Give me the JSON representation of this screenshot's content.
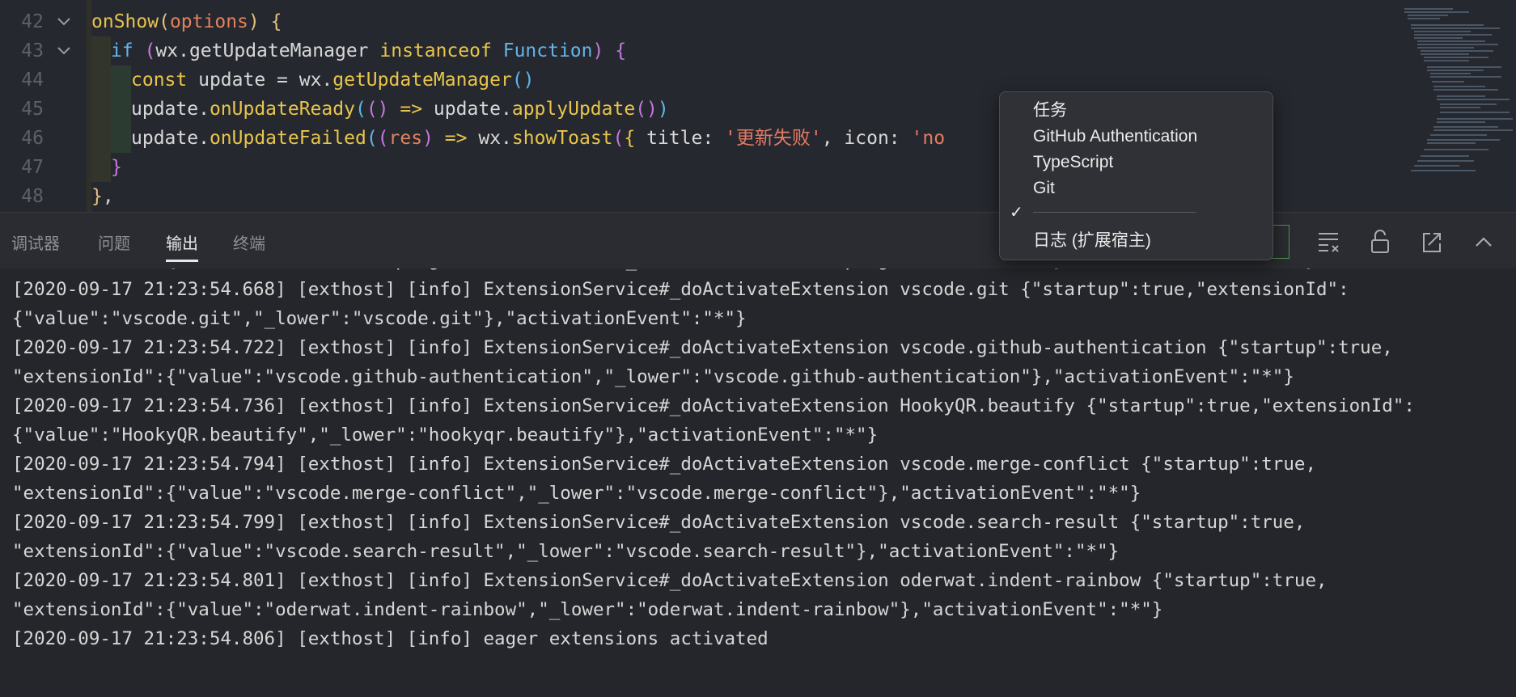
{
  "editor": {
    "lines": [
      {
        "num": "42",
        "tokens": [
          [
            "kw-fn",
            "onShow"
          ],
          [
            "p-orange",
            "("
          ],
          [
            "param",
            "options"
          ],
          [
            "p-orange",
            ")"
          ],
          [
            "sym",
            " "
          ],
          [
            "p-orange",
            "{"
          ]
        ],
        "indent": 0,
        "fold": true
      },
      {
        "num": "43",
        "tokens": [
          [
            "kw",
            "if"
          ],
          [
            "sym",
            " "
          ],
          [
            "paren-p",
            "("
          ],
          [
            "prop",
            "wx.getUpdateManager "
          ],
          [
            "kw2",
            "instanceof"
          ],
          [
            "sym",
            " "
          ],
          [
            "cls",
            "Function"
          ],
          [
            "paren-p",
            ")"
          ],
          [
            "sym",
            " "
          ],
          [
            "paren-p",
            "{"
          ]
        ],
        "indent": 1,
        "fold": true
      },
      {
        "num": "44",
        "tokens": [
          [
            "kw2",
            "const"
          ],
          [
            "sym",
            " update = wx."
          ],
          [
            "call",
            "getUpdateManager"
          ],
          [
            "paren-b",
            "()"
          ]
        ],
        "indent": 2,
        "fold": false
      },
      {
        "num": "45",
        "tokens": [
          [
            "sym",
            "update."
          ],
          [
            "call",
            "onUpdateReady"
          ],
          [
            "paren-b",
            "("
          ],
          [
            "paren-p",
            "()"
          ],
          [
            "sym",
            " "
          ],
          [
            "op",
            "=>"
          ],
          [
            "sym",
            " update."
          ],
          [
            "call",
            "applyUpdate"
          ],
          [
            "paren-p",
            "()"
          ],
          [
            "paren-b",
            ")"
          ]
        ],
        "indent": 2,
        "fold": false
      },
      {
        "num": "46",
        "tokens": [
          [
            "sym",
            "update."
          ],
          [
            "call",
            "onUpdateFailed"
          ],
          [
            "paren-b",
            "("
          ],
          [
            "paren-p",
            "("
          ],
          [
            "param",
            "res"
          ],
          [
            "paren-p",
            ")"
          ],
          [
            "sym",
            " "
          ],
          [
            "op",
            "=>"
          ],
          [
            "sym",
            " wx."
          ],
          [
            "call",
            "showToast"
          ],
          [
            "paren-p",
            "("
          ],
          [
            "op",
            "{"
          ],
          [
            "sym",
            " title: "
          ],
          [
            "str",
            "'更新失败'"
          ],
          [
            "sym",
            ", icon: "
          ],
          [
            "str",
            "'no"
          ]
        ],
        "indent": 2,
        "fold": false
      },
      {
        "num": "47",
        "tokens": [
          [
            "paren-p",
            "}"
          ]
        ],
        "indent": 1,
        "fold": false
      },
      {
        "num": "48",
        "tokens": [
          [
            "p-orange",
            "}"
          ],
          [
            "sym",
            ","
          ]
        ],
        "indent": 0,
        "fold": false
      }
    ]
  },
  "panel": {
    "tabs": [
      {
        "label": "调试器",
        "active": false
      },
      {
        "label": "问题",
        "active": false
      },
      {
        "label": "输出",
        "active": true
      },
      {
        "label": "终端",
        "active": false
      }
    ],
    "icons": [
      "clear-output-icon",
      "lock-scroll-icon",
      "open-log-icon",
      "maximize-panel-icon"
    ]
  },
  "dropdown": {
    "items": [
      "任务",
      "GitHub Authentication",
      "TypeScript",
      "Git"
    ],
    "selected": "日志 (扩展宿主)"
  },
  "output": {
    "lines": [
      "\"extensionId\":{\"value\":\"wechat.miniprogram.emmet-wxml\",\"_lower\":\"wechat.miniprogram.emmet-wxml\"},\"activationEvent\":\"*\"}",
      "[2020-09-17 21:23:54.668] [exthost] [info] ExtensionService#_doActivateExtension vscode.git {\"startup\":true,\"extensionId\":",
      "{\"value\":\"vscode.git\",\"_lower\":\"vscode.git\"},\"activationEvent\":\"*\"}",
      "[2020-09-17 21:23:54.722] [exthost] [info] ExtensionService#_doActivateExtension vscode.github-authentication {\"startup\":true,",
      "\"extensionId\":{\"value\":\"vscode.github-authentication\",\"_lower\":\"vscode.github-authentication\"},\"activationEvent\":\"*\"}",
      "[2020-09-17 21:23:54.736] [exthost] [info] ExtensionService#_doActivateExtension HookyQR.beautify {\"startup\":true,\"extensionId\":",
      "{\"value\":\"HookyQR.beautify\",\"_lower\":\"hookyqr.beautify\"},\"activationEvent\":\"*\"}",
      "[2020-09-17 21:23:54.794] [exthost] [info] ExtensionService#_doActivateExtension vscode.merge-conflict {\"startup\":true,",
      "\"extensionId\":{\"value\":\"vscode.merge-conflict\",\"_lower\":\"vscode.merge-conflict\"},\"activationEvent\":\"*\"}",
      "[2020-09-17 21:23:54.799] [exthost] [info] ExtensionService#_doActivateExtension vscode.search-result {\"startup\":true,",
      "\"extensionId\":{\"value\":\"vscode.search-result\",\"_lower\":\"vscode.search-result\"},\"activationEvent\":\"*\"}",
      "[2020-09-17 21:23:54.801] [exthost] [info] ExtensionService#_doActivateExtension oderwat.indent-rainbow {\"startup\":true,",
      "\"extensionId\":{\"value\":\"oderwat.indent-rainbow\",\"_lower\":\"oderwat.indent-rainbow\"},\"activationEvent\":\"*\"}",
      "[2020-09-17 21:23:54.806] [exthost] [info] eager extensions activated"
    ]
  }
}
